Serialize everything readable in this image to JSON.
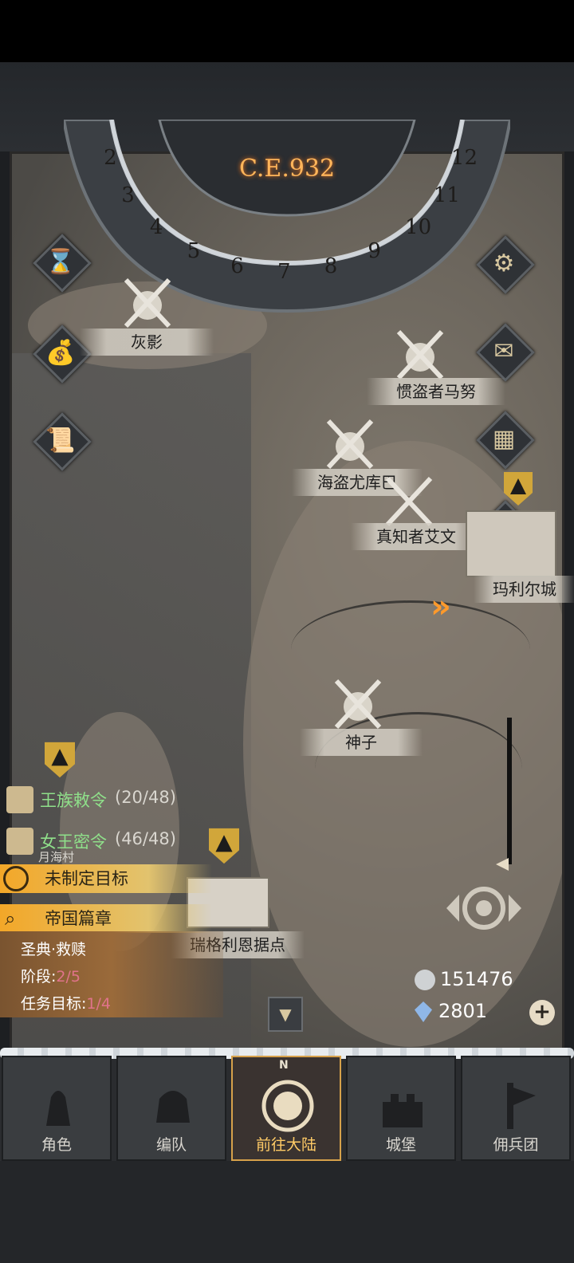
{
  "header": {
    "era": "C.E.932"
  },
  "dial_months": [
    "2",
    "3",
    "4",
    "5",
    "6",
    "7",
    "8",
    "9",
    "10",
    "11",
    "12"
  ],
  "side_buttons_left": [
    {
      "name": "hourglass-icon",
      "glyph": "⌛"
    },
    {
      "name": "money-bag-icon",
      "glyph": "💰"
    },
    {
      "name": "scroll-icon",
      "glyph": "📜"
    }
  ],
  "side_buttons_right": [
    {
      "name": "gear-icon",
      "glyph": "⚙"
    },
    {
      "name": "mail-icon",
      "glyph": "✉"
    },
    {
      "name": "grid-icon",
      "glyph": "▦"
    },
    {
      "name": "coin-icon",
      "glyph": "●"
    }
  ],
  "map_labels": {
    "huiying": "灰影",
    "guandao": "惯盗者马努",
    "haidao": "海盗尤库巴",
    "zhenzhi": "真知者艾文",
    "mali": "玛利尔城",
    "shenzi": "神子",
    "yuehai": "月海村",
    "ruige": "瑞格利恩据点"
  },
  "quests": {
    "royal": {
      "name": "王族敕令",
      "progress": "(20/48)"
    },
    "queen": {
      "name": "女王密令",
      "progress": "(46/48)"
    },
    "target": "未制定目标",
    "chapter": "帝国篇章",
    "task_title": "圣典·救赎",
    "stage_label": "阶段:",
    "stage_value": "2/5",
    "goal_label": "任务目标:",
    "goal_value": "1/4"
  },
  "currency": {
    "silver": "151476",
    "gems": "2801"
  },
  "nav": [
    {
      "label": "角色",
      "name": "nav-tab-character"
    },
    {
      "label": "编队",
      "name": "nav-tab-formation"
    },
    {
      "label": "前往大陆",
      "name": "nav-tab-continent",
      "active": true
    },
    {
      "label": "城堡",
      "name": "nav-tab-castle"
    },
    {
      "label": "佣兵团",
      "name": "nav-tab-mercenary"
    }
  ],
  "compass_letter": "N"
}
